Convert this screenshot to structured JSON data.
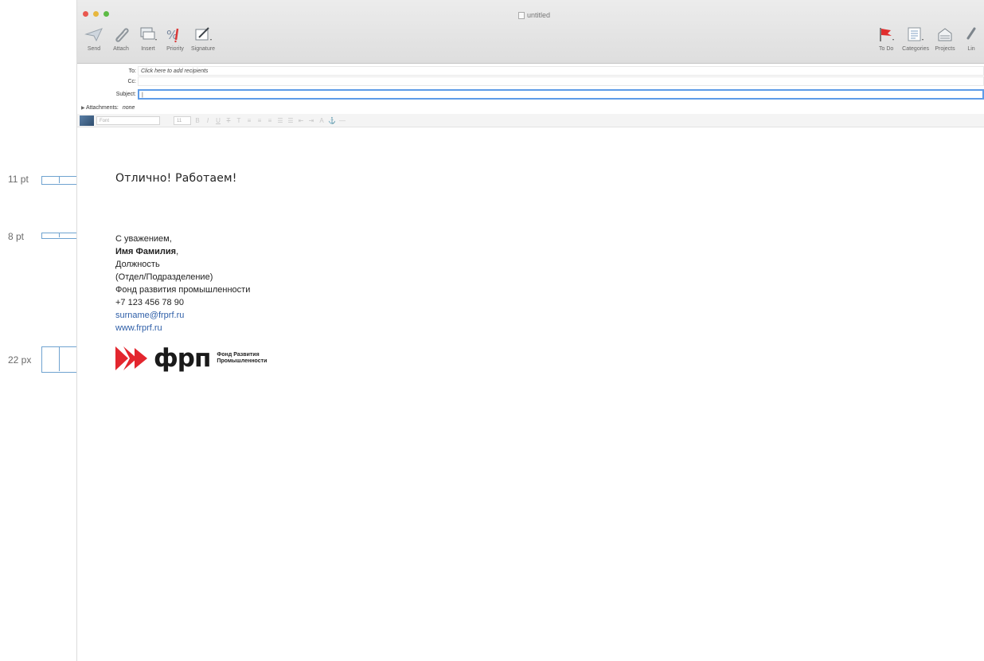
{
  "window": {
    "title": "untitled"
  },
  "toolbar": {
    "left": [
      {
        "label": "Send",
        "icon": "send-icon"
      },
      {
        "label": "Attach",
        "icon": "paperclip-icon"
      },
      {
        "label": "Insert",
        "icon": "insert-icon"
      },
      {
        "label": "Priority",
        "icon": "priority-icon"
      },
      {
        "label": "Signature",
        "icon": "signature-icon"
      }
    ],
    "right": [
      {
        "label": "To Do",
        "icon": "flag-icon"
      },
      {
        "label": "Categories",
        "icon": "categories-icon"
      },
      {
        "label": "Projects",
        "icon": "projects-icon"
      },
      {
        "label": "Lin",
        "icon": "link-icon"
      }
    ]
  },
  "header": {
    "to_label": "To:",
    "to_placeholder": "Click here to add recipients",
    "cc_label": "Cc:",
    "subject_label": "Subject:",
    "subject_value": "|",
    "attachments_label": "Attachments:",
    "attachments_value": "none"
  },
  "format_bar": {
    "font_placeholder": "Font",
    "size_value": "11"
  },
  "body": {
    "greeting": "Отлично! Работаем!",
    "signature": {
      "line1": "С уважением,",
      "name": "Имя Фамилия",
      "name_suffix": ",",
      "position": "Должность",
      "department": "(Отдел/Подразделение)",
      "org": "Фонд развития промышленности",
      "phone": "+7 123 456 78 90",
      "email": "surname@frprf.ru",
      "site": "www.frprf.ru"
    },
    "logo": {
      "word": "фрп",
      "sub_line1": "Фонд Развития",
      "sub_line2": "Промышленности",
      "accent_color": "#e3262e"
    }
  },
  "annotations": {
    "greeting_size": "11 pt",
    "signature_size": "8 pt",
    "logo_height": "22 px"
  },
  "colors": {
    "link": "#2f5fa8",
    "focus": "#5e9ce8",
    "bracket": "#6fa3d0"
  }
}
